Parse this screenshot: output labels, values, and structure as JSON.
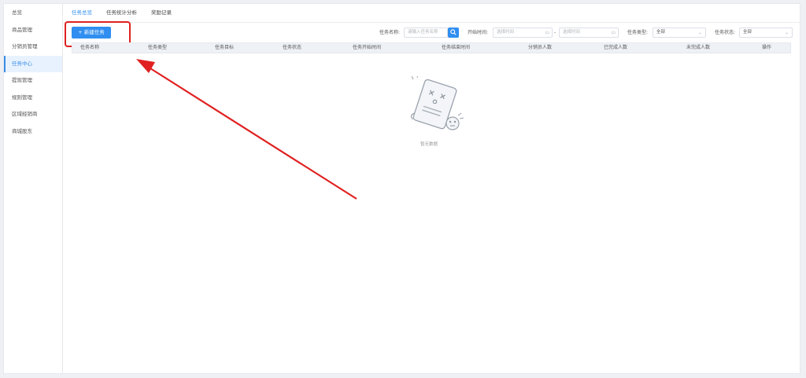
{
  "sidebar": {
    "items": [
      {
        "label": "总览",
        "active": false
      },
      {
        "label": "商品管理",
        "active": false
      },
      {
        "label": "分销员管理",
        "active": false
      },
      {
        "label": "任务中心",
        "active": true
      },
      {
        "label": "提现管理",
        "active": false
      },
      {
        "label": "规则管理",
        "active": false
      },
      {
        "label": "区域经销商",
        "active": false
      },
      {
        "label": "商城股东",
        "active": false
      }
    ]
  },
  "tabs": [
    {
      "label": "任务总览",
      "active": true
    },
    {
      "label": "任务统计分析",
      "active": false
    },
    {
      "label": "奖励记录",
      "active": false
    }
  ],
  "toolbar": {
    "new_task_label": "+ 新建任务"
  },
  "filters": {
    "task_name_label": "任务名称:",
    "task_name_placeholder": "请输入任务名称",
    "start_time_label": "开始时间:",
    "start_date_placeholder": "选择时间",
    "range_separator": "-",
    "end_date_placeholder": "选择时间",
    "task_type_label": "任务类型:",
    "task_type_value": "全部",
    "task_status_label": "任务状态:",
    "task_status_value": "全部"
  },
  "table": {
    "columns": [
      "任务名称",
      "任务类型",
      "任务目标",
      "任务状态",
      "任务开始时间",
      "任务结束时间",
      "分销员人数",
      "已完成人数",
      "未完成人数",
      "操作"
    ],
    "rows": [],
    "empty_text": "暂无数据"
  },
  "colors": {
    "accent": "#2f8ef0",
    "highlight": "#e02020"
  }
}
